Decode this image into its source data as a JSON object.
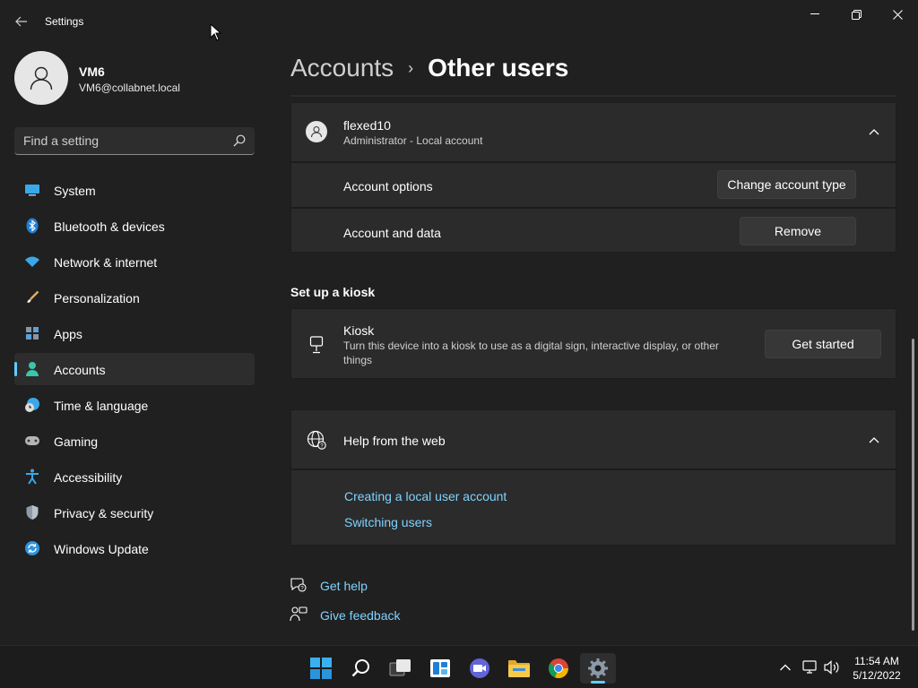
{
  "window": {
    "title": "Settings"
  },
  "profile": {
    "name": "VM6",
    "email": "VM6@collabnet.local"
  },
  "search": {
    "placeholder": "Find a setting"
  },
  "sidebar": {
    "items": [
      {
        "label": "System",
        "icon": "system-icon"
      },
      {
        "label": "Bluetooth & devices",
        "icon": "bluetooth-icon"
      },
      {
        "label": "Network & internet",
        "icon": "wifi-icon"
      },
      {
        "label": "Personalization",
        "icon": "brush-icon"
      },
      {
        "label": "Apps",
        "icon": "apps-icon"
      },
      {
        "label": "Accounts",
        "icon": "person-icon",
        "active": true
      },
      {
        "label": "Time & language",
        "icon": "clock-globe-icon"
      },
      {
        "label": "Gaming",
        "icon": "gamepad-icon"
      },
      {
        "label": "Accessibility",
        "icon": "accessibility-icon"
      },
      {
        "label": "Privacy & security",
        "icon": "shield-icon"
      },
      {
        "label": "Windows Update",
        "icon": "update-icon"
      }
    ]
  },
  "breadcrumb": {
    "parent": "Accounts",
    "current": "Other users"
  },
  "user_card": {
    "name": "flexed10",
    "subtitle": "Administrator - Local account",
    "account_options_label": "Account options",
    "change_type_button": "Change account type",
    "account_data_label": "Account and data",
    "remove_button": "Remove"
  },
  "kiosk": {
    "section_title": "Set up a kiosk",
    "title": "Kiosk",
    "description_line1": "Turn this device into a kiosk to use as a digital sign, interactive display, or other",
    "description_line2": "things",
    "button": "Get started"
  },
  "help": {
    "title": "Help from the web",
    "links": [
      "Creating a local user account",
      "Switching users"
    ]
  },
  "footer": {
    "get_help": "Get help",
    "give_feedback": "Give feedback"
  },
  "taskbar": {
    "time": "11:54 AM",
    "date": "5/12/2022"
  },
  "colors": {
    "background": "#202020",
    "card": "#2b2b2b",
    "accent": "#60cdff",
    "link": "#7fd3ff"
  }
}
